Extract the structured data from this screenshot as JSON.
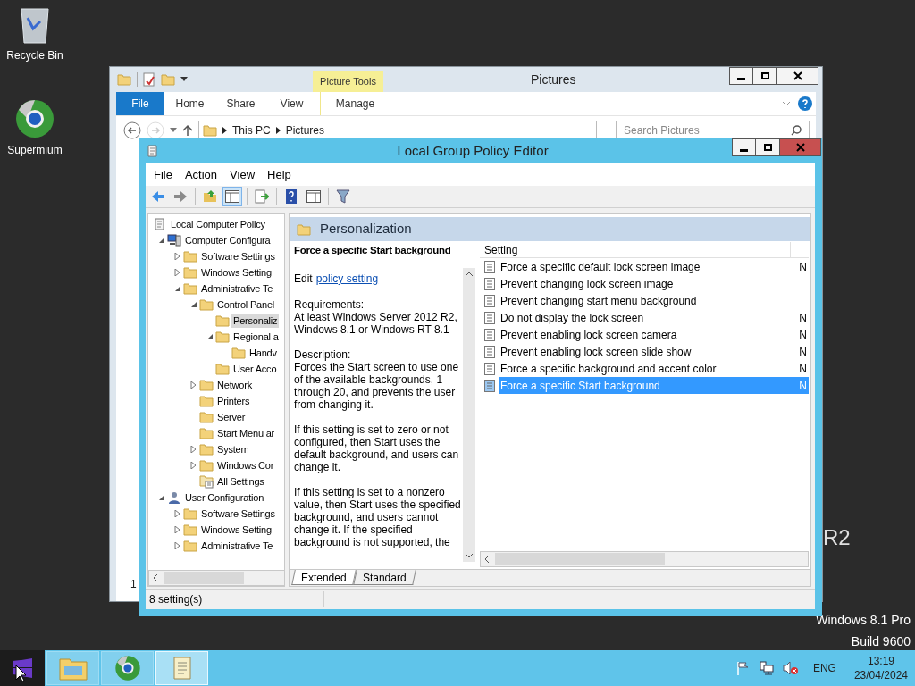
{
  "desktop_icons": [
    {
      "kind": "recycle-bin",
      "label": "Recycle Bin"
    },
    {
      "kind": "browser",
      "label": "Supermium"
    }
  ],
  "desktop_text": {
    "fragment": "R2",
    "edition": "Windows 8.1 Pro",
    "build": "Build 9600"
  },
  "explorer": {
    "title": "Pictures",
    "contextual_tab": "Picture Tools",
    "ribbon_tabs": [
      {
        "kind": "file",
        "label": "File",
        "selected": false
      },
      {
        "kind": "tab",
        "label": "Home",
        "selected": false
      },
      {
        "kind": "tab",
        "label": "Share",
        "selected": false
      },
      {
        "kind": "tab",
        "label": "View",
        "selected": false
      },
      {
        "kind": "contextual",
        "label": "Manage",
        "selected": false
      }
    ],
    "breadcrumb": [
      "This PC",
      "Pictures"
    ],
    "search": {
      "placeholder": "Search Pictures"
    },
    "status_fragment": "1"
  },
  "gpe": {
    "title": "Local Group Policy Editor",
    "menu": [
      "File",
      "Action",
      "View",
      "Help"
    ],
    "toolbar": [
      {
        "kind": "back",
        "pressed": false
      },
      {
        "kind": "forward",
        "pressed": false
      },
      {
        "kind": "sep"
      },
      {
        "kind": "up",
        "pressed": false
      },
      {
        "kind": "tree",
        "pressed": true
      },
      {
        "kind": "sep"
      },
      {
        "kind": "export",
        "pressed": false
      },
      {
        "kind": "sep"
      },
      {
        "kind": "help",
        "pressed": false
      },
      {
        "kind": "panel",
        "pressed": false
      },
      {
        "kind": "sep"
      },
      {
        "kind": "filter",
        "pressed": false
      }
    ],
    "tree": [
      {
        "label": "Local Computer Policy",
        "kind": "policy",
        "selected": false,
        "children": [
          {
            "label": "Computer Configura",
            "kind": "computer",
            "expanded": true,
            "selected": false,
            "children": [
              {
                "label": "Software Settings",
                "kind": "folder",
                "expanded": false,
                "selected": false
              },
              {
                "label": "Windows Setting",
                "kind": "folder",
                "expanded": false,
                "selected": false
              },
              {
                "label": "Administrative Te",
                "kind": "folder",
                "expanded": true,
                "selected": false,
                "children": [
                  {
                    "label": "Control Panel",
                    "kind": "folder",
                    "expanded": true,
                    "selected": false,
                    "children": [
                      {
                        "label": "Personaliz",
                        "kind": "folder",
                        "selected": true
                      },
                      {
                        "label": "Regional a",
                        "kind": "folder",
                        "expanded": true,
                        "selected": false,
                        "children": [
                          {
                            "label": "Handv",
                            "kind": "folder",
                            "selected": false
                          }
                        ]
                      },
                      {
                        "label": "User Acco",
                        "kind": "folder",
                        "selected": false
                      }
                    ]
                  },
                  {
                    "label": "Network",
                    "kind": "folder",
                    "expanded": false,
                    "selected": false
                  },
                  {
                    "label": "Printers",
                    "kind": "folder",
                    "selected": false
                  },
                  {
                    "label": "Server",
                    "kind": "folder",
                    "selected": false
                  },
                  {
                    "label": "Start Menu ar",
                    "kind": "folder",
                    "selected": false
                  },
                  {
                    "label": "System",
                    "kind": "folder",
                    "expanded": false,
                    "selected": false
                  },
                  {
                    "label": "Windows Cor",
                    "kind": "folder",
                    "expanded": false,
                    "selected": false
                  },
                  {
                    "label": "All Settings",
                    "kind": "settings",
                    "selected": false
                  }
                ]
              }
            ]
          },
          {
            "label": "User Configuration",
            "kind": "user",
            "expanded": true,
            "selected": false,
            "children": [
              {
                "label": "Software Settings",
                "kind": "folder",
                "expanded": false,
                "selected": false
              },
              {
                "label": "Windows Setting",
                "kind": "folder",
                "expanded": false,
                "selected": false
              },
              {
                "label": "Administrative Te",
                "kind": "folder",
                "expanded": false,
                "selected": false
              }
            ]
          }
        ]
      }
    ],
    "header": "Personalization",
    "extended": {
      "title": "Force a specific Start background",
      "edit": "Edit",
      "link": "policy setting",
      "paragraphs": [
        [
          "Requirements:",
          "At least Windows Server 2012 R2, Windows 8.1 or Windows RT 8.1"
        ],
        [
          "Description:",
          "Forces the Start screen to use one of the available backgrounds, 1 through 20, and prevents the user from changing it."
        ],
        [
          "If this setting is set to zero or not configured, then Start uses the default background, and users can change it."
        ],
        [
          "If this setting is set to a nonzero value, then Start uses the specified background, and users cannot change it. If the specified background is not supported, the"
        ]
      ]
    },
    "list": {
      "columns": [
        "Setting"
      ],
      "rows": [
        {
          "name": "Force a specific default lock screen image",
          "state": "N",
          "selected": false
        },
        {
          "name": "Prevent changing lock screen image",
          "selected": false
        },
        {
          "name": "Prevent changing start menu background",
          "selected": false
        },
        {
          "name": "Do not display the lock screen",
          "state": "N",
          "selected": false
        },
        {
          "name": "Prevent enabling lock screen camera",
          "state": "N",
          "selected": false
        },
        {
          "name": "Prevent enabling lock screen slide show",
          "state": "N",
          "selected": false
        },
        {
          "name": "Force a specific background and accent color",
          "state": "N",
          "selected": false
        },
        {
          "name": "Force a specific Start background",
          "state": "N",
          "selected": true
        }
      ]
    },
    "view_tabs": [
      {
        "label": "Extended",
        "selected": true
      },
      {
        "label": "Standard",
        "selected": false
      }
    ],
    "status": "8 setting(s)"
  },
  "taskbar": {
    "apps": [
      {
        "kind": "explorer",
        "active": false
      },
      {
        "kind": "browser",
        "active": false
      },
      {
        "kind": "policy",
        "active": true
      }
    ],
    "language": "ENG",
    "time": "13:19",
    "date": "23/04/2024"
  }
}
